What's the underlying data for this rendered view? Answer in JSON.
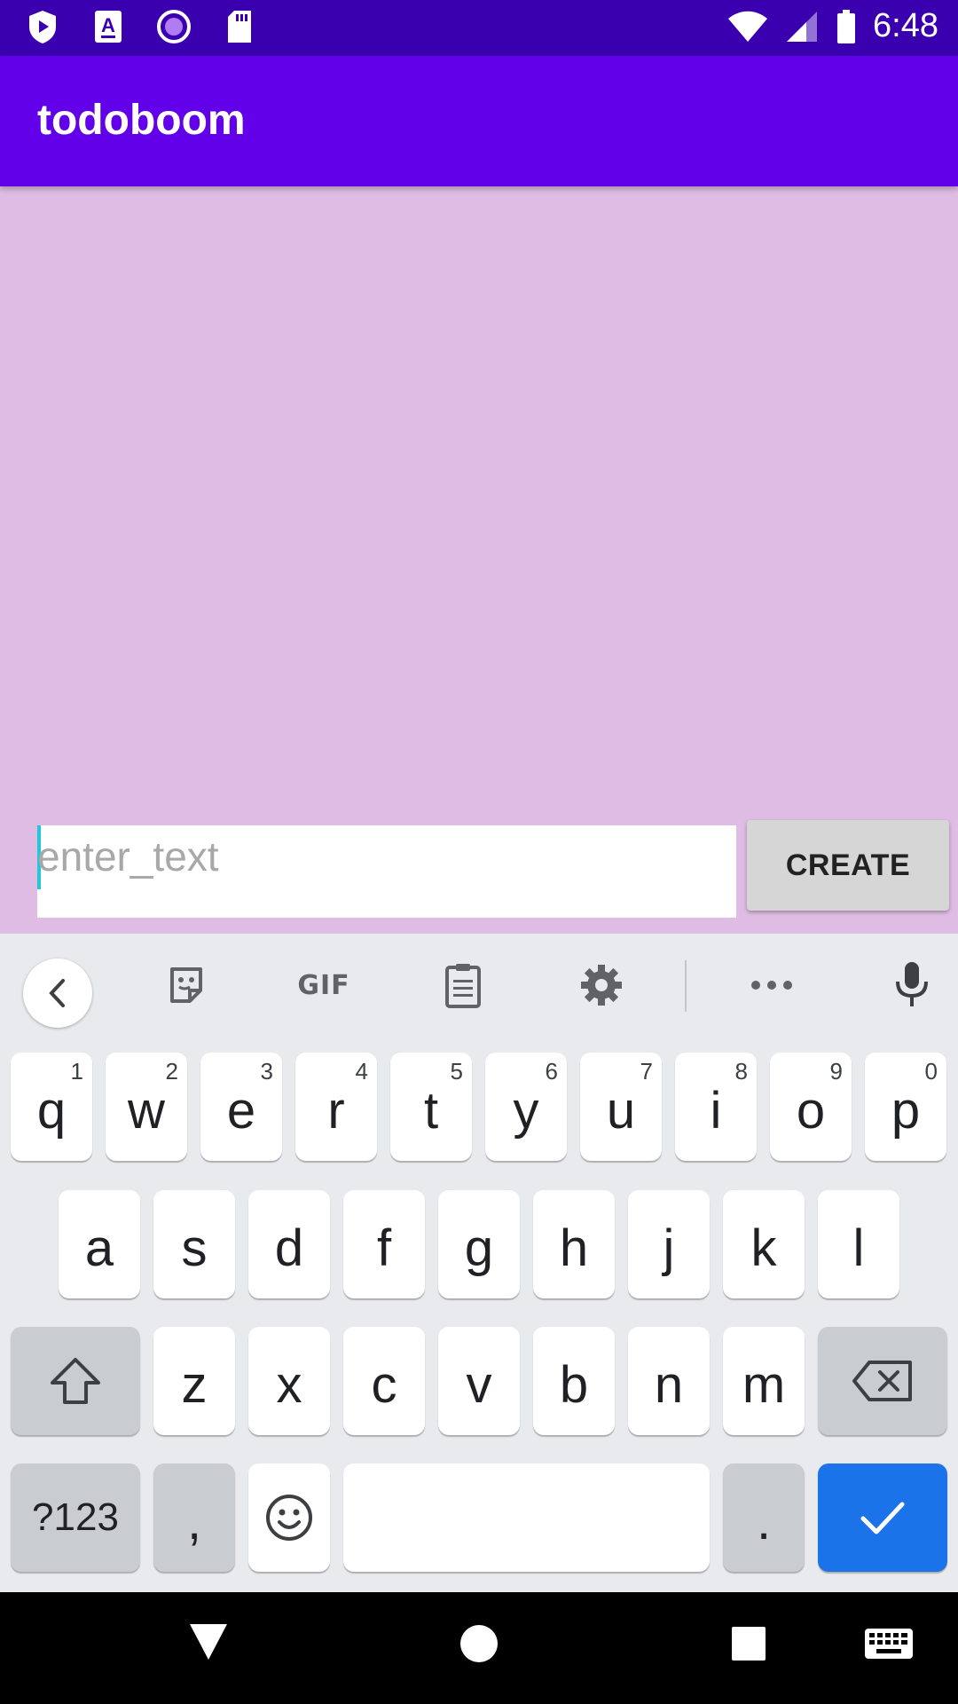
{
  "status_bar": {
    "time": "6:48",
    "left_icons": [
      "play-protect-icon",
      "font-a-icon",
      "record-icon",
      "sd-card-icon"
    ],
    "right_icons": [
      "wifi-icon",
      "cell-signal-icon",
      "battery-icon"
    ]
  },
  "app_bar": {
    "title": "todoboom",
    "color": "#6200ea"
  },
  "main": {
    "background": "#dfbce3",
    "input": {
      "value": "",
      "placeholder": "enter_text"
    },
    "create_button_label": "CREATE"
  },
  "keyboard": {
    "toolbar": [
      "back-chevron-icon",
      "sticker-icon",
      "gif-icon",
      "clipboard-icon",
      "settings-gear-icon",
      "more-dots-icon",
      "microphone-icon"
    ],
    "gif_label": "GIF",
    "row1": [
      {
        "label": "q",
        "hint": "1"
      },
      {
        "label": "w",
        "hint": "2"
      },
      {
        "label": "e",
        "hint": "3"
      },
      {
        "label": "r",
        "hint": "4"
      },
      {
        "label": "t",
        "hint": "5"
      },
      {
        "label": "y",
        "hint": "6"
      },
      {
        "label": "u",
        "hint": "7"
      },
      {
        "label": "i",
        "hint": "8"
      },
      {
        "label": "o",
        "hint": "9"
      },
      {
        "label": "p",
        "hint": "0"
      }
    ],
    "row2": [
      "a",
      "s",
      "d",
      "f",
      "g",
      "h",
      "j",
      "k",
      "l"
    ],
    "row3": [
      "z",
      "x",
      "c",
      "v",
      "b",
      "n",
      "m"
    ],
    "row4": {
      "symbols_label": "?123",
      "comma_label": ",",
      "period_label": "."
    },
    "enter_color": "#1a73e8"
  },
  "nav_bar": {
    "items": [
      "back-triangle-icon",
      "home-circle-icon",
      "recents-square-icon",
      "keyboard-switch-icon"
    ]
  }
}
